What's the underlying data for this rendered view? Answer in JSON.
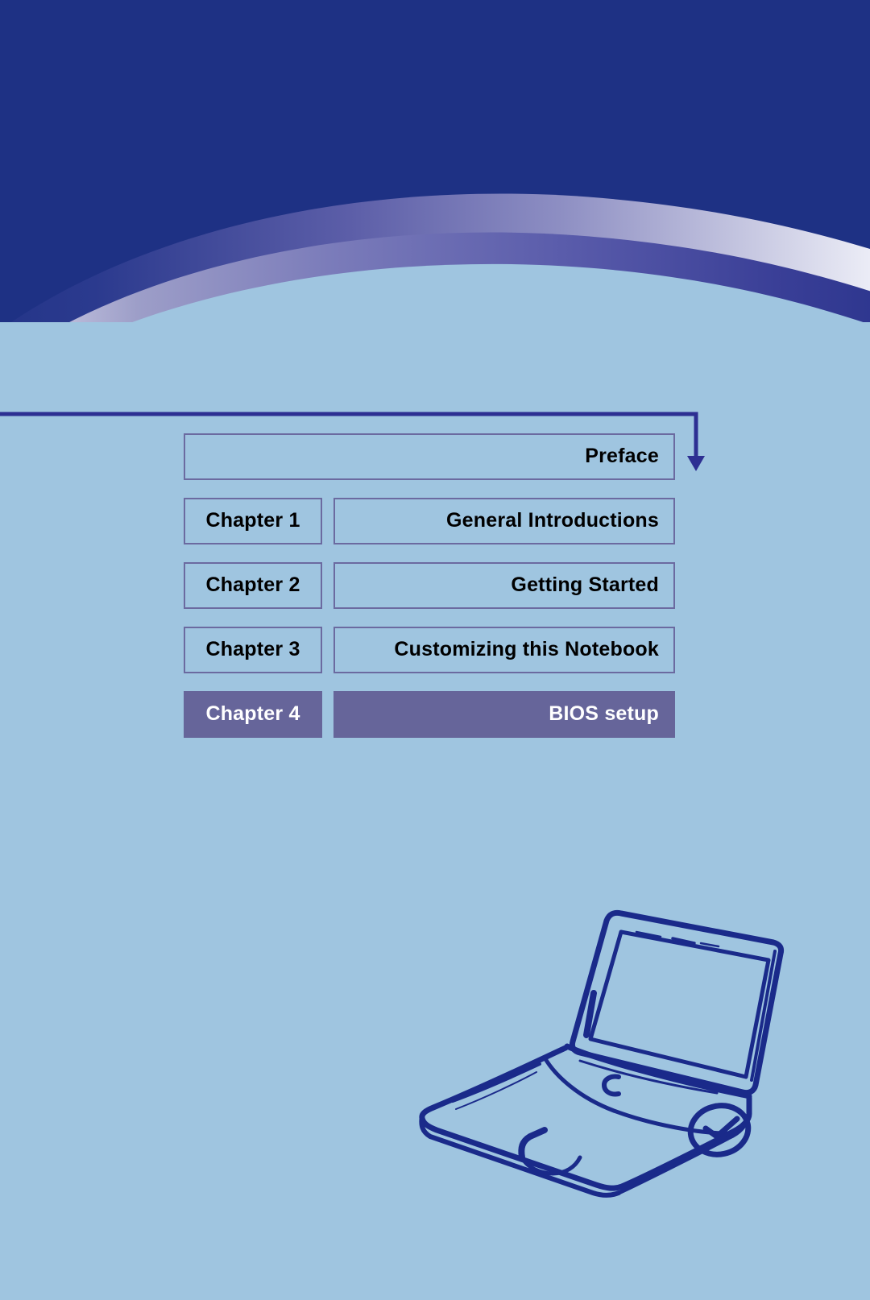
{
  "page": {
    "background_navy": "#1e3184",
    "background_light_blue": "#9fc5e0",
    "accent_purple": "#66659a",
    "border_purple": "#6b6aa0",
    "arrow_color": "#2d2f92",
    "sketch_color": "#1a2a8a"
  },
  "toc": {
    "rows": [
      {
        "chapter": "",
        "title": "Preface",
        "active": false,
        "full_width": true
      },
      {
        "chapter": "Chapter  1",
        "title": "General Introductions",
        "active": false,
        "full_width": false
      },
      {
        "chapter": "Chapter  2",
        "title": "Getting Started",
        "active": false,
        "full_width": false
      },
      {
        "chapter": "Chapter  3",
        "title": "Customizing  this  Notebook",
        "active": false,
        "full_width": false
      },
      {
        "chapter": "Chapter  4",
        "title": "BIOS setup",
        "active": true,
        "full_width": false
      }
    ]
  },
  "decor": {
    "banner_name": "swoosh-banner",
    "arrow_name": "preface-connector-arrow",
    "illustration_name": "notebook-sketch-illustration",
    "clock_name": "clock-sketch-icon"
  }
}
